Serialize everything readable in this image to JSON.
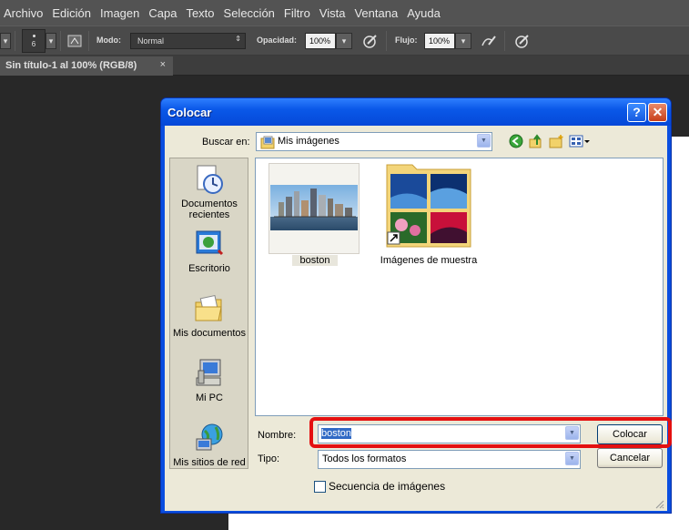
{
  "menu": [
    "Archivo",
    "Edición",
    "Imagen",
    "Capa",
    "Texto",
    "Selección",
    "Filtro",
    "Vista",
    "Ventana",
    "Ayuda"
  ],
  "options_bar": {
    "brush_size": "6",
    "mode_label": "Modo:",
    "mode_value": "Normal",
    "opacity_label": "Opacidad:",
    "opacity_value": "100%",
    "flow_label": "Flujo:",
    "flow_value": "100%"
  },
  "document_tab": {
    "title": "Sin título-1 al 100% (RGB/8)",
    "close": "×"
  },
  "dialog": {
    "title": "Colocar",
    "help": "?",
    "close": "✕",
    "look_in_label": "Buscar en:",
    "look_in_value": "Mis imágenes",
    "places": [
      {
        "label": "Documentos recientes",
        "icon": "recent-documents-icon"
      },
      {
        "label": "Escritorio",
        "icon": "desktop-icon"
      },
      {
        "label": "Mis documentos",
        "icon": "my-documents-icon"
      },
      {
        "label": "Mi PC",
        "icon": "my-computer-icon"
      },
      {
        "label": "Mis sitios de red",
        "icon": "network-places-icon"
      }
    ],
    "files": [
      {
        "label": "boston",
        "icon": "image-thumbnail-icon"
      },
      {
        "label": "Imágenes de muestra",
        "icon": "folder-shortcut-icon"
      }
    ],
    "name_label": "Nombre:",
    "name_value": "boston",
    "type_label": "Tipo:",
    "type_value": "Todos los formatos",
    "place_button": "Colocar",
    "cancel_button": "Cancelar",
    "sequence_label": "Secuencia de imágenes"
  },
  "colors": {
    "highlight": "#e41010",
    "xp_blue": "#0a58e8"
  }
}
